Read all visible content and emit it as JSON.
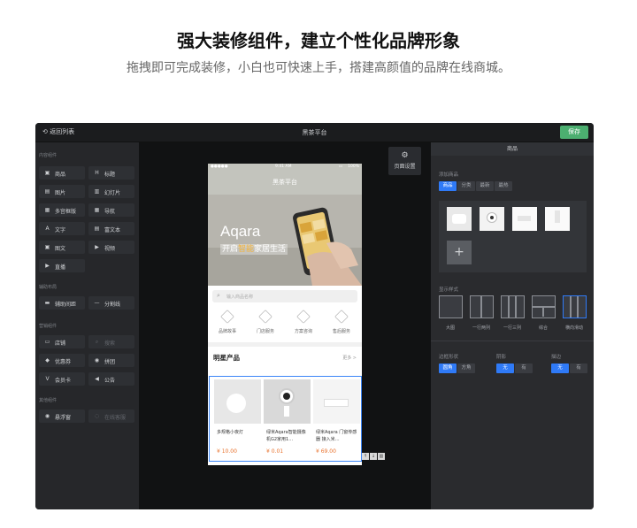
{
  "hero": {
    "title": "强大装修组件，建立个性化品牌形象",
    "subtitle": "拖拽即可完成装修，小白也可快速上手，搭建高颜值的品牌在线商城。"
  },
  "topbar": {
    "back_label": "返回列表",
    "title": "黑茶平台",
    "save_label": "保存"
  },
  "left_panel": {
    "sections": [
      {
        "title": "内容组件",
        "items": [
          {
            "icon": "goods-icon",
            "glyph": "▣",
            "label": "商品"
          },
          {
            "icon": "heading-icon",
            "glyph": "H",
            "label": "标题"
          },
          {
            "icon": "image-icon",
            "glyph": "▤",
            "label": "图片"
          },
          {
            "icon": "slideshow-icon",
            "glyph": "▥",
            "label": "幻灯片"
          },
          {
            "icon": "multi-grid-icon",
            "glyph": "▦",
            "label": "多宫框版"
          },
          {
            "icon": "nav-icon",
            "glyph": "▦",
            "label": "导航"
          },
          {
            "icon": "text-icon",
            "glyph": "A",
            "label": "文字"
          },
          {
            "icon": "richtext-icon",
            "glyph": "▤",
            "label": "富文本"
          },
          {
            "icon": "image-text-icon",
            "glyph": "▣",
            "label": "图文"
          },
          {
            "icon": "video-icon",
            "glyph": "▶",
            "label": "视频"
          },
          {
            "icon": "live-icon",
            "glyph": "▶",
            "label": "直播"
          }
        ]
      },
      {
        "title": "辅助布局",
        "items": [
          {
            "icon": "spacer-icon",
            "glyph": "▬",
            "label": "辅助间距"
          },
          {
            "icon": "divider-icon",
            "glyph": "—",
            "label": "分割线"
          }
        ]
      },
      {
        "title": "营销组件",
        "items": [
          {
            "icon": "store-icon",
            "glyph": "▭",
            "label": "店铺"
          },
          {
            "icon": "search-icon",
            "glyph": "⌕",
            "label": "搜索",
            "disabled": true
          },
          {
            "icon": "coupon-icon",
            "glyph": "◆",
            "label": "优惠券"
          },
          {
            "icon": "group-buy-icon",
            "glyph": "◉",
            "label": "拼团"
          },
          {
            "icon": "member-card-icon",
            "glyph": "V",
            "label": "会员卡"
          },
          {
            "icon": "notice-icon",
            "glyph": "◀",
            "label": "公告"
          }
        ]
      },
      {
        "title": "其他组件",
        "items": [
          {
            "icon": "suspend-window-icon",
            "glyph": "◉",
            "label": "悬浮窗"
          },
          {
            "icon": "online-service-icon",
            "glyph": "◌",
            "label": "在线客服",
            "disabled": true
          }
        ]
      }
    ]
  },
  "canvas": {
    "page_settings_label": "页面设置"
  },
  "phone": {
    "status_time": "9:41 AM",
    "status_battery": "100%",
    "nav_title": "黑茶平台",
    "banner_brand": "Aqara",
    "banner_slogan_prefix": "开启",
    "banner_slogan_highlight": "智能",
    "banner_slogan_suffix": "家居生活",
    "search_placeholder": "输入商品名称",
    "services": [
      {
        "icon": "brand-story-icon",
        "label": "品牌故事"
      },
      {
        "icon": "store-service-icon",
        "label": "门店服务"
      },
      {
        "icon": "solution-icon",
        "label": "方案咨询"
      },
      {
        "icon": "after-sale-icon",
        "label": "售后服务"
      }
    ],
    "section_title": "明星产品",
    "more_label": "更多 >",
    "products": [
      {
        "name": "多规格小夜灯",
        "price": "¥ 10.00"
      },
      {
        "name": "绿米Aqara智能摄像机G2家用1…",
        "price": "¥ 0.01"
      },
      {
        "name": "绿米Aqara 门窗传感器 接入米…",
        "price": "¥ 69.00"
      }
    ]
  },
  "right_panel": {
    "tab_label": "商品",
    "add_goods_label": "添加商品",
    "source_tabs": [
      "商品",
      "分类",
      "最新",
      "最热"
    ],
    "display_style_label": "显示样式",
    "styles": [
      "大图",
      "一行两列",
      "一行三列",
      "综合",
      "横向滑动"
    ],
    "border_label": "边框形状",
    "border_options": [
      "圆角",
      "方角"
    ],
    "shadow_label": "阴影",
    "shadow_options": [
      "无",
      "有"
    ],
    "stroke_label": "描边",
    "stroke_options": [
      "无",
      "有"
    ],
    "colors": {
      "accent": "#2f7af7",
      "save": "#4caf70",
      "price": "#e8712c"
    }
  }
}
